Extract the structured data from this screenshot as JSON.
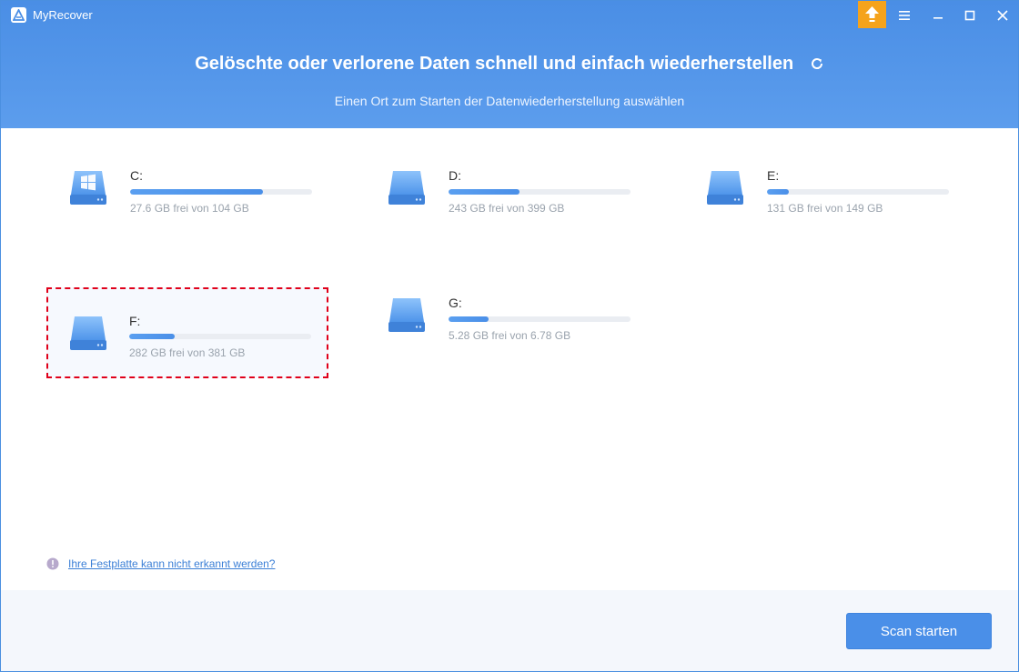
{
  "app": {
    "name": "MyRecover"
  },
  "header": {
    "title": "Gelöschte oder verlorene Daten schnell und einfach wiederherstellen",
    "subtitle": "Einen Ort zum Starten der Datenwiederherstellung auswählen"
  },
  "drives": [
    {
      "label": "C:",
      "size_text": "27.6 GB frei von 104 GB",
      "used_percent": 73,
      "icon": "windows-drive-icon"
    },
    {
      "label": "D:",
      "size_text": "243 GB frei von 399 GB",
      "used_percent": 39,
      "icon": "drive-icon"
    },
    {
      "label": "E:",
      "size_text": "131 GB frei von 149 GB",
      "used_percent": 12,
      "icon": "drive-icon"
    },
    {
      "label": "F:",
      "size_text": "282 GB frei von 381 GB",
      "used_percent": 25,
      "icon": "drive-icon",
      "selected": true
    },
    {
      "label": "G:",
      "size_text": "5.28 GB frei von 6.78 GB",
      "used_percent": 22,
      "icon": "drive-icon"
    }
  ],
  "help": {
    "link_text": "Ihre Festplatte kann nicht erkannt werden?"
  },
  "footer": {
    "scan_label": "Scan starten"
  },
  "colors": {
    "accent": "#4a8fe8",
    "upgrade": "#f5a31c",
    "selection": "#e0001a"
  }
}
